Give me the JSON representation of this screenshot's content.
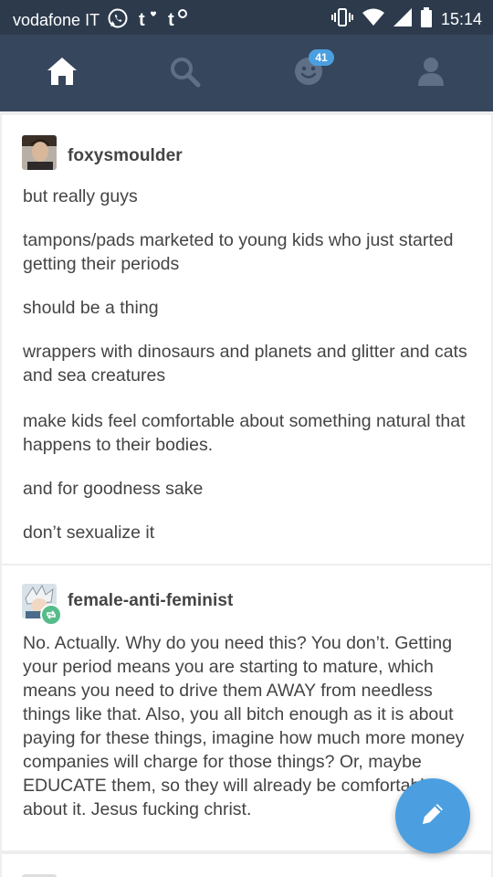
{
  "status_bar": {
    "carrier": "vodafone IT",
    "time": "15:14"
  },
  "nav": {
    "items": [
      "home-icon",
      "search-icon",
      "activity-icon",
      "account-icon"
    ],
    "activity_badge": "41"
  },
  "posts": [
    {
      "username": "foxysmoulder",
      "paragraphs": [
        "but really guys",
        "tampons/pads marketed to young kids who just started getting their periods",
        "should be a thing",
        "wrappers with dinosaurs and planets and glitter and cats and sea creatures",
        "make kids feel comfortable about something natural that happens to their bodies.",
        "and for goodness sake",
        "don’t sexualize it"
      ]
    },
    {
      "username": "female-anti-feminist",
      "paragraphs": [
        "No. Actually. Why do you need this? You don’t. Getting your period means you are starting to mature, which means you need to drive them AWAY from needless things like that. Also, you all bitch enough as it is about paying for these things, imagine how much more money companies will charge for those things? Or, maybe EDUCATE them, so they will already be comfortable about it. Jesus fucking christ."
      ]
    }
  ],
  "colors": {
    "navbar": "#36465d",
    "statusbar": "#2c3a4c",
    "accent": "#4b9fe0",
    "reblog": "#56bc8a"
  }
}
